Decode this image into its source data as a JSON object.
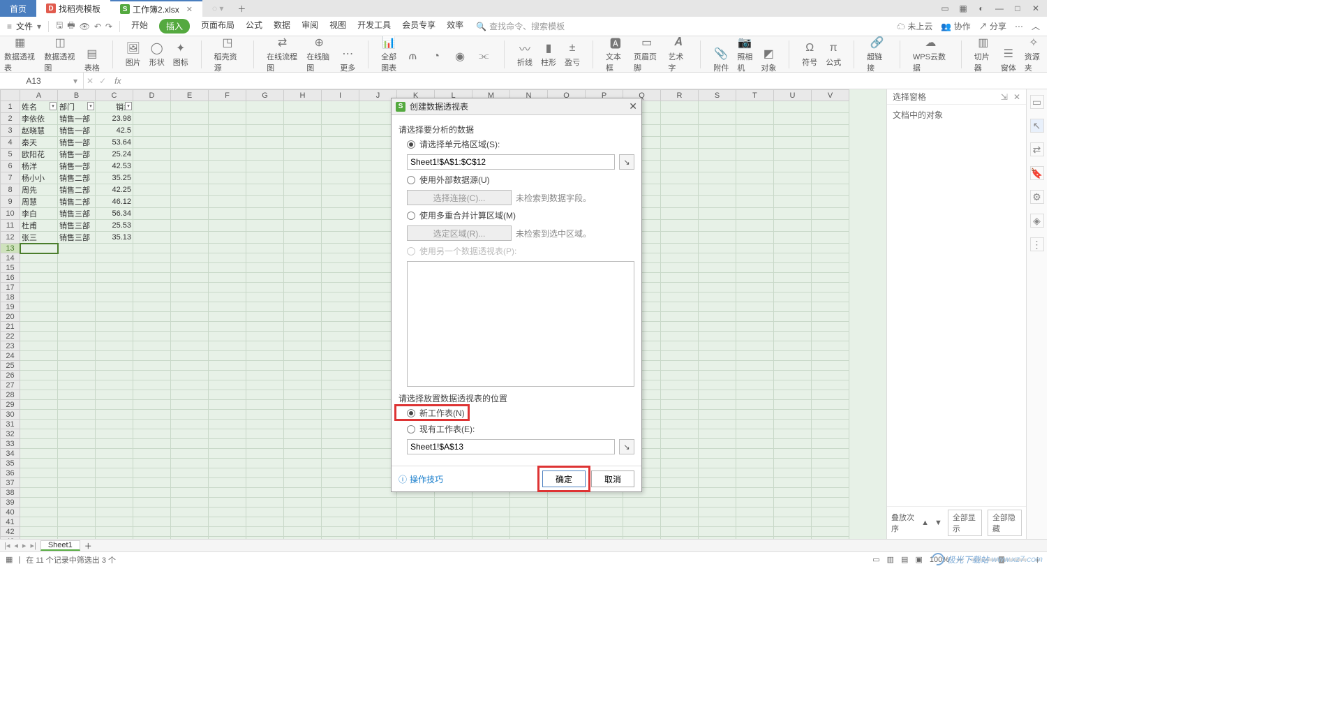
{
  "tabs": {
    "home": "首页",
    "template": "找稻壳模板",
    "file": "工作簿2.xlsx"
  },
  "menu": {
    "file": "文件",
    "tabs": [
      "开始",
      "插入",
      "页面布局",
      "公式",
      "数据",
      "审阅",
      "视图",
      "开发工具",
      "会员专享",
      "效率"
    ],
    "active_index": 1,
    "search_placeholder": "查找命令、搜索模板"
  },
  "menu_right": {
    "cloud": "未上云",
    "coop": "协作",
    "share": "分享"
  },
  "ribbon": {
    "items": [
      "数据透视表",
      "数据透视图",
      "表格",
      "图片",
      "形状",
      "图标",
      "稻壳资源",
      "在线流程图",
      "在线脑图",
      "更多",
      "全部图表",
      "折线",
      "柱形",
      "盈亏",
      "文本框",
      "页眉页脚",
      "艺术字",
      "附件",
      "对象",
      "符号",
      "公式",
      "超链接",
      "WPS云数据",
      "切片器",
      "窗体",
      "资源夹"
    ],
    "camera": "照相机"
  },
  "formula_bar": {
    "namebox": "A13",
    "fx": "fx"
  },
  "columns": [
    "A",
    "B",
    "C",
    "D",
    "E",
    "F",
    "G",
    "H",
    "I",
    "J",
    "K",
    "L",
    "M",
    "N",
    "O",
    "P",
    "Q",
    "R",
    "S",
    "T",
    "U",
    "V"
  ],
  "headers": {
    "name": "姓名",
    "dept": "部门",
    "sales": "销量"
  },
  "rows": [
    {
      "n": "李依依",
      "d": "销售一部",
      "s": "23.98"
    },
    {
      "n": "赵晓慧",
      "d": "销售一部",
      "s": "42.5"
    },
    {
      "n": "秦天",
      "d": "销售一部",
      "s": "53.64"
    },
    {
      "n": "欧阳花",
      "d": "销售一部",
      "s": "25.24"
    },
    {
      "n": "杨洋",
      "d": "销售一部",
      "s": "42.53"
    },
    {
      "n": "杨小小",
      "d": "销售二部",
      "s": "35.25"
    },
    {
      "n": "周先",
      "d": "销售二部",
      "s": "42.25"
    },
    {
      "n": "周慧",
      "d": "销售二部",
      "s": "46.12"
    },
    {
      "n": "李白",
      "d": "销售三部",
      "s": "56.34"
    },
    {
      "n": "杜甫",
      "d": "销售三部",
      "s": "25.53"
    },
    {
      "n": "张三",
      "d": "销售三部",
      "s": "35.13"
    }
  ],
  "selected_row": 13,
  "dialog": {
    "title": "创建数据透视表",
    "sec1": "请选择要分析的数据",
    "r_range": "请选择单元格区域(S):",
    "range_val": "Sheet1!$A$1:$C$12",
    "r_ext": "使用外部数据源(U)",
    "btn_conn": "选择连接(C)...",
    "hint_conn": "未检索到数据字段。",
    "r_multi": "使用多重合并计算区域(M)",
    "btn_region": "选定区域(R)...",
    "hint_region": "未检索到选中区域。",
    "r_other": "使用另一个数据透视表(P):",
    "sec2": "请选择放置数据透视表的位置",
    "r_new": "新工作表(N)",
    "r_exist": "现有工作表(E):",
    "loc_val": "Sheet1!$A$13",
    "link": "操作技巧",
    "ok": "确定",
    "cancel": "取消"
  },
  "rpane": {
    "title": "选择窗格",
    "sub": "文档中的对象",
    "order": "叠放次序",
    "showall": "全部显示",
    "hideall": "全部隐藏"
  },
  "sheet": {
    "name": "Sheet1"
  },
  "status": {
    "filter": "在 11 个记录中筛选出 3 个",
    "zoom": "100%"
  },
  "watermark": {
    "t1": "极光下载站",
    "t2": "www.xz7.com"
  }
}
